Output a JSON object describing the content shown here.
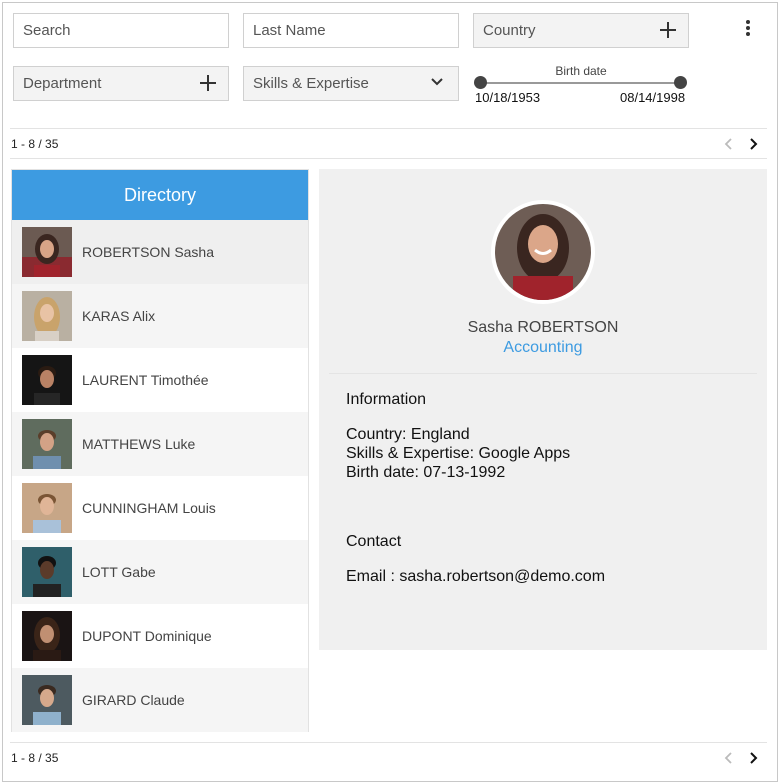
{
  "filters": {
    "search_placeholder": "Search",
    "last_name_placeholder": "Last Name",
    "country_label": "Country",
    "department_label": "Department",
    "skills_label": "Skills & Expertise"
  },
  "birth_slider": {
    "label": "Birth date",
    "min": "10/18/1953",
    "max": "08/14/1998"
  },
  "pager": {
    "text": "1 - 8 / 35"
  },
  "directory": {
    "title": "Directory",
    "people": [
      {
        "name": "ROBERTSON Sasha"
      },
      {
        "name": "KARAS Alix"
      },
      {
        "name": "LAURENT Timothée"
      },
      {
        "name": "MATTHEWS Luke"
      },
      {
        "name": "CUNNINGHAM Louis"
      },
      {
        "name": "LOTT Gabe"
      },
      {
        "name": "DUPONT Dominique"
      },
      {
        "name": "GIRARD Claude"
      }
    ]
  },
  "detail": {
    "name": "Sasha ROBERTSON",
    "department": "Accounting",
    "info_heading": "Information",
    "country_line": "Country: England",
    "skills_line": "Skills & Expertise: Google Apps",
    "birth_line": "Birth date: 07-13-1992",
    "contact_heading": "Contact",
    "email_line": "Email : sasha.robertson@demo.com"
  },
  "colors": {
    "accent": "#3d9be1",
    "panel": "#f0f0f0"
  },
  "icons": [
    "plus-icon",
    "chevron-down-icon",
    "more-vertical-icon",
    "chevron-left-icon",
    "chevron-right-icon"
  ]
}
